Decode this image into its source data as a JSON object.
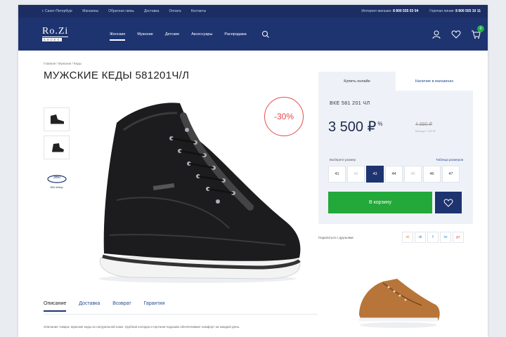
{
  "topbar": {
    "city": "г. Санкт-Петербург",
    "links": [
      "Магазины",
      "Обратная связь",
      "Доставка",
      "Оплата",
      "Контакты"
    ],
    "service_label": "Интернет-магазин:",
    "service_phone": "8 800 555 03 04",
    "hotline_label": "Горячая линия:",
    "hotline_phone": "8 800 555 10 11"
  },
  "header": {
    "logo_main": "Ro.Zi",
    "logo_sub": "SHOES",
    "menu": [
      "Женские",
      "Мужские",
      "Детские",
      "Аксессуары",
      "Распродажа"
    ],
    "active_menu_index": 0,
    "cart_count": "0"
  },
  "breadcrumbs": "Главная / Мужские / Кеды",
  "product": {
    "title": "МУЖСКИЕ КЕДЫ 581201Ч/Л",
    "discount_badge": "-30%",
    "thumb_360_label": "360 обзор"
  },
  "info_tabs": [
    "Описание",
    "Доставка",
    "Возврат",
    "Гарантия"
  ],
  "description": "Описание товара: мужские кеды из натуральной кожи. Удобная колодка и прочная подошва обеспечивают комфорт на каждый день.",
  "panel": {
    "tabs": [
      "Купить онлайн",
      "Наличие в магазинах"
    ],
    "sku": "ВКЕ 581 201 ЧЛ",
    "price": "3 500 ₽",
    "price_note": "%",
    "old_price": "4 990 ₽",
    "saving": "Выгода 1 490 ₽",
    "size_label": "Выберите размер",
    "size_table_link": "Таблица размеров",
    "sizes": [
      "41",
      "42",
      "43",
      "44",
      "45",
      "46",
      "47"
    ],
    "sizes_disabled": [
      false,
      true,
      false,
      false,
      true,
      false,
      false
    ],
    "selected_size_index": 2,
    "add_to_cart": "В корзину",
    "share_label": "Поделиться с друзьями:"
  },
  "social": [
    "ok",
    "vk",
    "f",
    "tw",
    "g+"
  ],
  "colors": {
    "brand_navy": "#1e3470",
    "topbar_navy": "#1b2d63",
    "cart_green": "#23a83a",
    "discount_red": "#e64b4b"
  }
}
